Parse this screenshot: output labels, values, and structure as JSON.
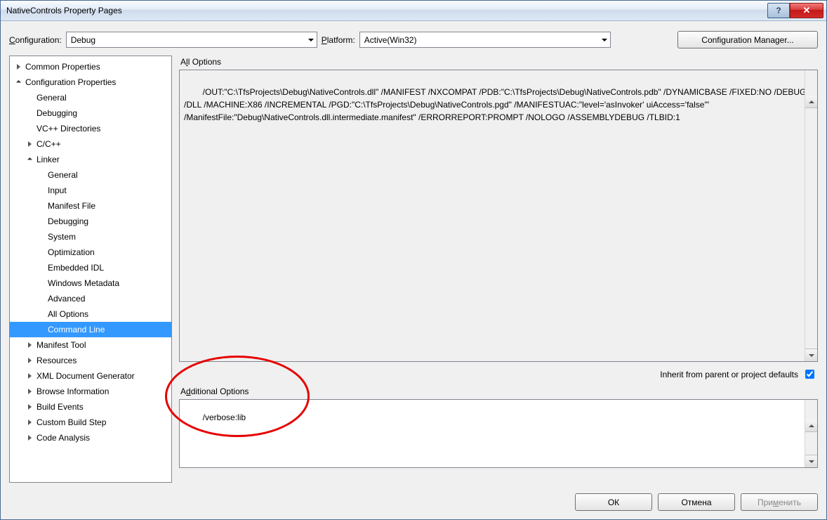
{
  "titlebar": {
    "title": "NativeControls Property Pages"
  },
  "top": {
    "configuration_label_pre": "C",
    "configuration_label_post": "onfiguration:",
    "configuration_value": "Debug",
    "platform_label_pre": "P",
    "platform_label_post": "latform:",
    "platform_value": "Active(Win32)",
    "config_manager_label": "Configuration Manager..."
  },
  "tree": {
    "common_properties": "Common Properties",
    "configuration_properties": "Configuration Properties",
    "general": "General",
    "debugging": "Debugging",
    "vcpp_directories": "VC++ Directories",
    "ccpp": "C/C++",
    "linker": "Linker",
    "linker_general": "General",
    "linker_input": "Input",
    "linker_manifest_file": "Manifest File",
    "linker_debugging": "Debugging",
    "linker_system": "System",
    "linker_optimization": "Optimization",
    "linker_embedded_idl": "Embedded IDL",
    "linker_windows_metadata": "Windows Metadata",
    "linker_advanced": "Advanced",
    "linker_all_options": "All Options",
    "linker_command_line": "Command Line",
    "manifest_tool": "Manifest Tool",
    "resources": "Resources",
    "xml_document_generator": "XML Document Generator",
    "browse_information": "Browse Information",
    "build_events": "Build Events",
    "custom_build_step": "Custom Build Step",
    "code_analysis": "Code Analysis"
  },
  "right": {
    "all_options_label_pre": "A",
    "all_options_label_ul": "l",
    "all_options_label_post": "l Options",
    "all_options_text": "/OUT:\"C:\\TfsProjects\\Debug\\NativeControls.dll\" /MANIFEST /NXCOMPAT /PDB:\"C:\\TfsProjects\\Debug\\NativeControls.pdb\" /DYNAMICBASE /FIXED:NO /DEBUG /DLL /MACHINE:X86 /INCREMENTAL /PGD:\"C:\\TfsProjects\\Debug\\NativeControls.pgd\" /MANIFESTUAC:\"level='asInvoker' uiAccess='false'\" /ManifestFile:\"Debug\\NativeControls.dll.intermediate.manifest\" /ERRORREPORT:PROMPT /NOLOGO /ASSEMBLYDEBUG /TLBID:1 ",
    "inherit_label": "Inherit from parent or project defaults",
    "inherit_checked": true,
    "additional_label_pre": "A",
    "additional_label_ul": "d",
    "additional_label_post": "ditional Options",
    "additional_text": "/verbose:lib"
  },
  "bottom": {
    "ok": "ОК",
    "cancel": "Отмена",
    "apply_pre": "При",
    "apply_ul": "м",
    "apply_post": "енить"
  }
}
